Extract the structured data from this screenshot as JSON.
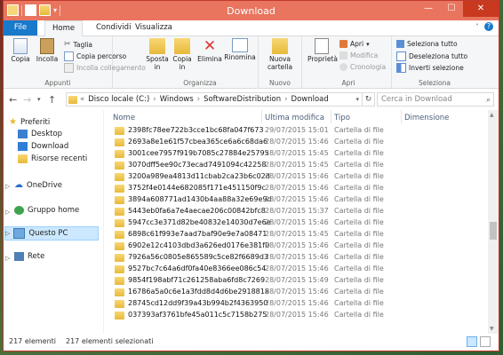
{
  "window": {
    "title": "Download"
  },
  "tabs": {
    "file": "File",
    "home": "Home",
    "share": "Condividi",
    "view": "Visualizza"
  },
  "ribbon": {
    "appunti": {
      "label": "Appunti",
      "copia": "Copia",
      "incolla": "Incolla",
      "taglia": "Taglia",
      "copia_percorso": "Copia percorso",
      "incolla_collegamento": "Incolla collegamento"
    },
    "organizza": {
      "label": "Organizza",
      "sposta_in_1": "Sposta",
      "sposta_in_2": "in",
      "copia_in_1": "Copia",
      "copia_in_2": "in",
      "elimina": "Elimina",
      "rinomina": "Rinomina"
    },
    "nuovo": {
      "label": "Nuovo",
      "nuova_cartella_1": "Nuova",
      "nuova_cartella_2": "cartella"
    },
    "apri": {
      "label": "Apri",
      "proprieta": "Proprietà",
      "apri": "Apri",
      "modifica": "Modifica",
      "cronologia": "Cronologia"
    },
    "seleziona": {
      "label": "Seleziona",
      "seleziona_tutto": "Seleziona tutto",
      "deseleziona_tutto": "Deseleziona tutto",
      "inverti_selezione": "Inverti selezione"
    }
  },
  "address": {
    "prefix": "«",
    "crumbs": [
      "Disco locale (C:)",
      "Windows",
      "SoftwareDistribution",
      "Download"
    ],
    "search_placeholder": "Cerca in Download"
  },
  "nav": {
    "preferiti": "Preferiti",
    "desktop": "Desktop",
    "download": "Download",
    "risorse_recenti": "Risorse recenti",
    "onedrive": "OneDrive",
    "gruppo_home": "Gruppo home",
    "questo_pc": "Questo PC",
    "rete": "Rete"
  },
  "columns": {
    "name": "Nome",
    "modified": "Ultima modifica",
    "type": "Tipo",
    "size": "Dimensione"
  },
  "files": [
    {
      "name": "2398fc78ee722b3cce1bc68fa047f673",
      "date": "29/07/2015 15:01",
      "type": "Cartella di file"
    },
    {
      "name": "2693a8e1e61f57cbea365ce6a6c68da6",
      "date": "28/07/2015 15:46",
      "type": "Cartella di file"
    },
    {
      "name": "3001cee7957f919b7085c27884e25795",
      "date": "28/07/2015 15:45",
      "type": "Cartella di file"
    },
    {
      "name": "3070dff5ee90c73ecad7491094c42258",
      "date": "28/07/2015 15:45",
      "type": "Cartella di file"
    },
    {
      "name": "3200a989ea4813d11cbab2ca23b6c02d",
      "date": "28/07/2015 15:46",
      "type": "Cartella di file"
    },
    {
      "name": "3752f4e0144e682085f171e451150f9c",
      "date": "28/07/2015 15:46",
      "type": "Cartella di file"
    },
    {
      "name": "3894a608771ad1430b4aa88a32e69e9d",
      "date": "28/07/2015 15:46",
      "type": "Cartella di file"
    },
    {
      "name": "5443eb0fa6a7e4aecae206c00842bfc8",
      "date": "28/07/2015 15:37",
      "type": "Cartella di file"
    },
    {
      "name": "5947cc3e371d82be40832e14030d7e6e",
      "date": "28/07/2015 15:46",
      "type": "Cartella di file"
    },
    {
      "name": "6898c61f993e7aad7baf90e9e7a08471",
      "date": "28/07/2015 15:45",
      "type": "Cartella di file"
    },
    {
      "name": "6902e12c4103dbd3a626ed0176e381f0",
      "date": "28/07/2015 15:46",
      "type": "Cartella di file"
    },
    {
      "name": "7926a56c0805e865589c5ce82f6689d3",
      "date": "28/07/2015 15:46",
      "type": "Cartella di file"
    },
    {
      "name": "9527bc7c64a6df0fa40e8366ee086c54",
      "date": "28/07/2015 15:46",
      "type": "Cartella di file"
    },
    {
      "name": "9854f198abf71c261258aba6fd8c7269",
      "date": "28/07/2015 15:49",
      "type": "Cartella di file"
    },
    {
      "name": "16786a5a0c6e1a3fdd8d4d6be2918818",
      "date": "28/07/2015 15:46",
      "type": "Cartella di file"
    },
    {
      "name": "28745cd12dd9f39a43b994b2f4363950",
      "date": "28/07/2015 15:46",
      "type": "Cartella di file"
    },
    {
      "name": "037393af3761bfe45a011c5c7158b275",
      "date": "28/07/2015 15:46",
      "type": "Cartella di file"
    }
  ],
  "status": {
    "count": "217 elementi",
    "selected": "217 elementi selezionati"
  },
  "colors": {
    "titlebar": "#e9755f",
    "file_tab": "#1979ca",
    "selection": "#cce8ff",
    "folder": "#e7b93b"
  }
}
